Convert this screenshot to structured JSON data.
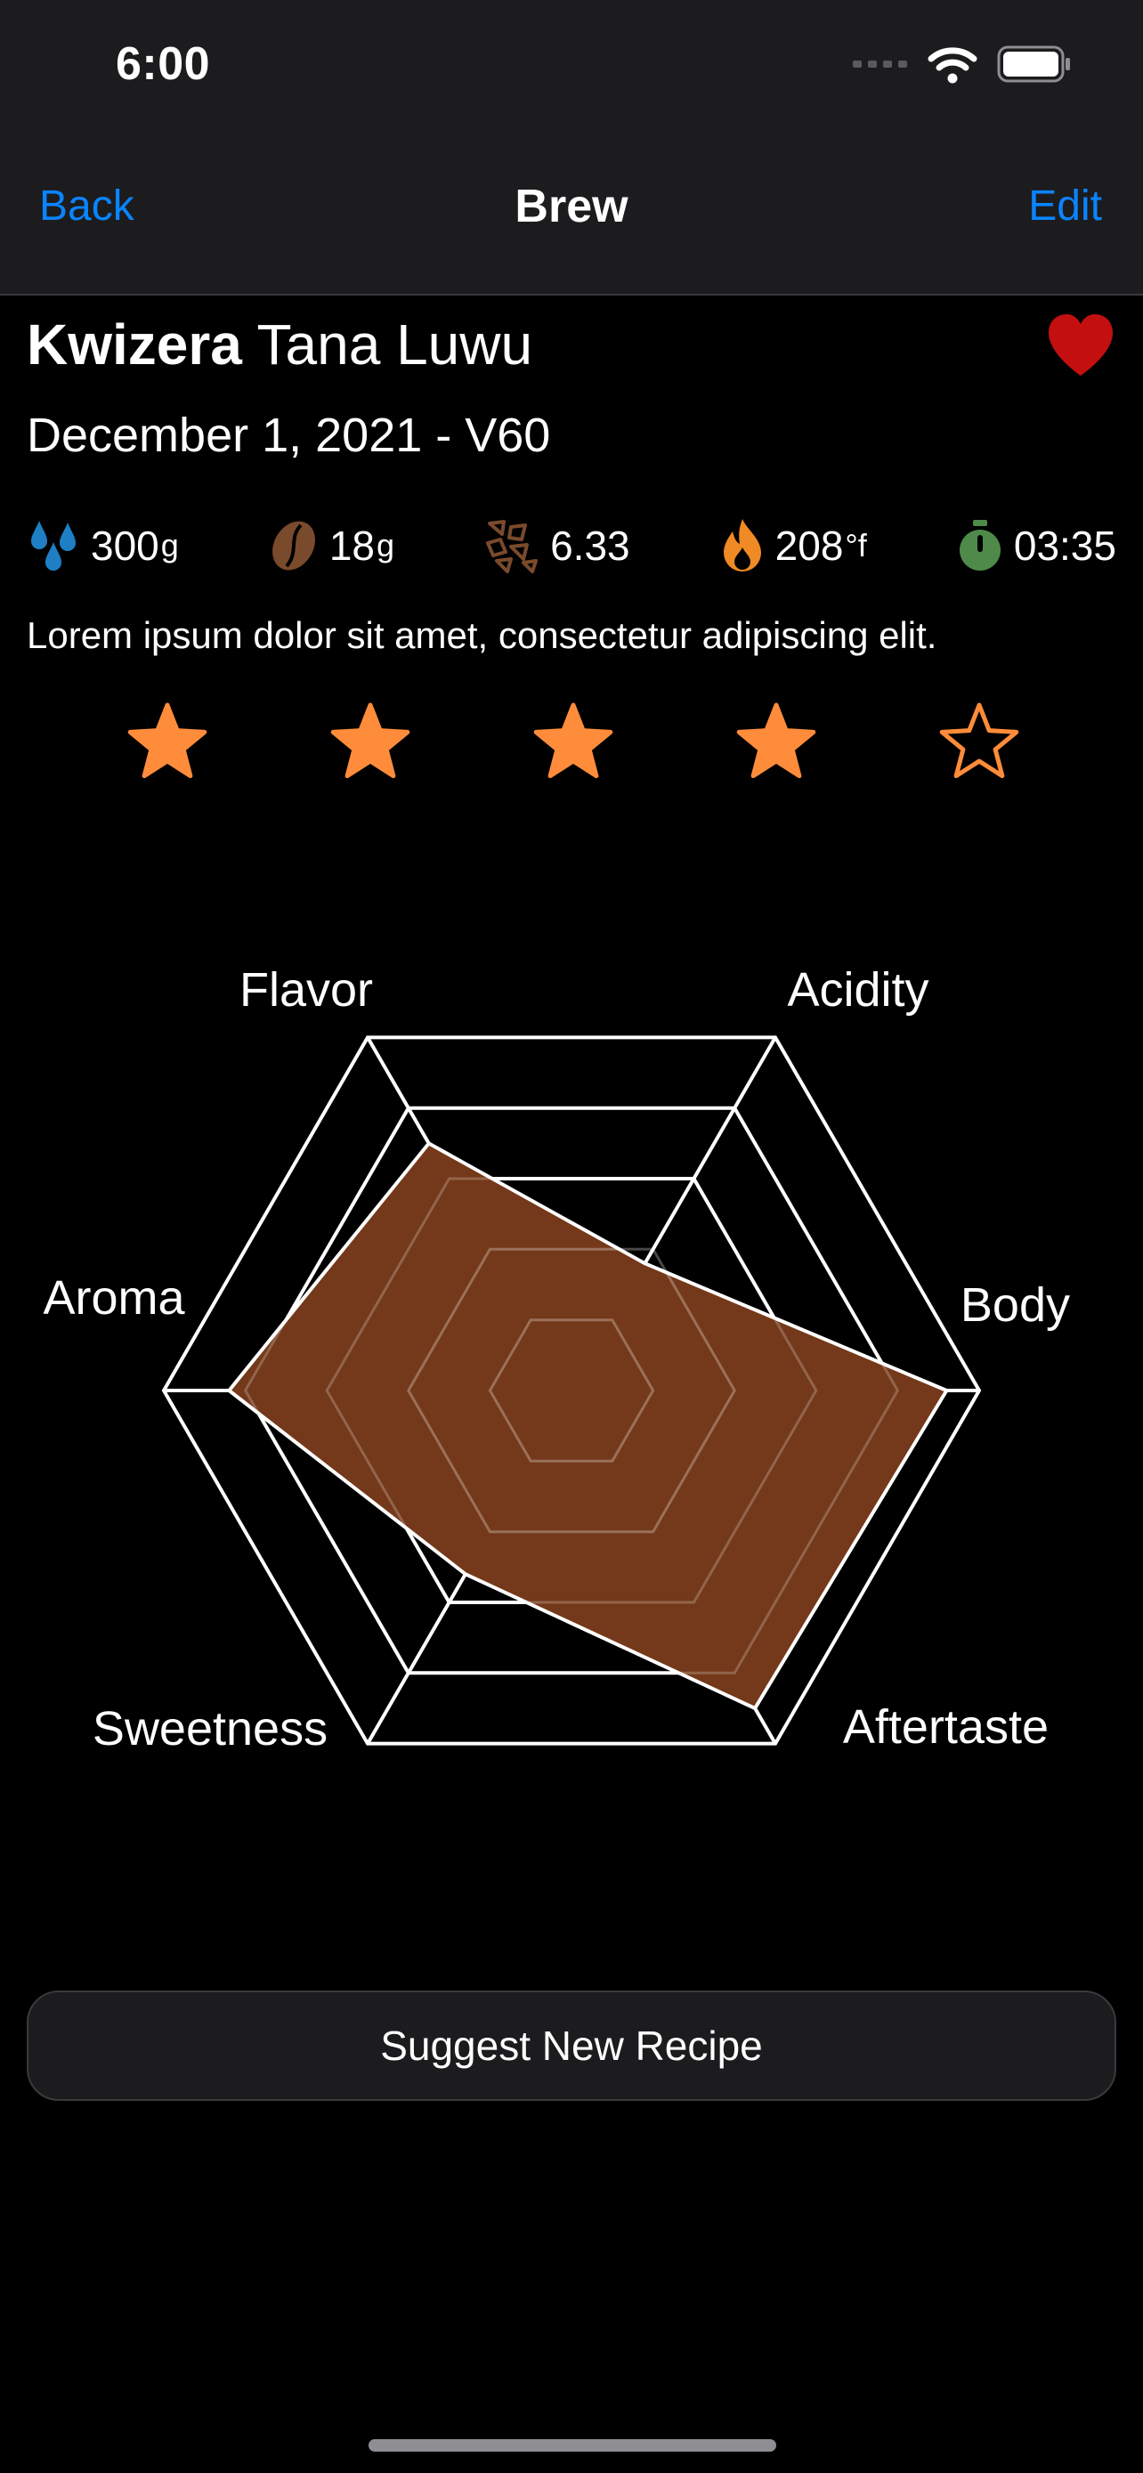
{
  "status_bar": {
    "time": "6:00"
  },
  "nav": {
    "back_label": "Back",
    "title": "Brew",
    "edit_label": "Edit"
  },
  "brew": {
    "roaster": "Kwizera",
    "coffee": "Tana Luwu",
    "date_method": "December 1, 2021 - V60",
    "favorite": true,
    "stats": {
      "water": {
        "value": "300",
        "unit": "g",
        "icon": "water-drops-icon",
        "color": "#1e7fc4"
      },
      "dose": {
        "value": "18",
        "unit": "g",
        "icon": "coffee-bean-icon",
        "color": "#7a4a2c"
      },
      "grind": {
        "value": "6.33",
        "icon": "grounds-icon",
        "color": "#7a4a2c"
      },
      "temperature": {
        "value": "208",
        "unit": "°f",
        "icon": "flame-icon",
        "color": "#f08a24"
      },
      "time": {
        "value": "03:35",
        "icon": "timer-icon",
        "color": "#4f8a4a"
      }
    },
    "notes": "Lorem ipsum dolor sit amet, consectetur adipiscing elit.",
    "rating": {
      "value": 4,
      "max": 5,
      "color": "#ff8c3a"
    }
  },
  "chart_data": {
    "type": "radar",
    "axes": [
      "Flavor",
      "Acidity",
      "Body",
      "Aftertaste",
      "Sweetness",
      "Aroma"
    ],
    "values": [
      3.5,
      1.8,
      4.6,
      4.5,
      2.6,
      4.2
    ],
    "max": 5,
    "fill_color": "#74391a",
    "grid_color": "#ffffff"
  },
  "actions": {
    "suggest_label": "Suggest New Recipe"
  }
}
